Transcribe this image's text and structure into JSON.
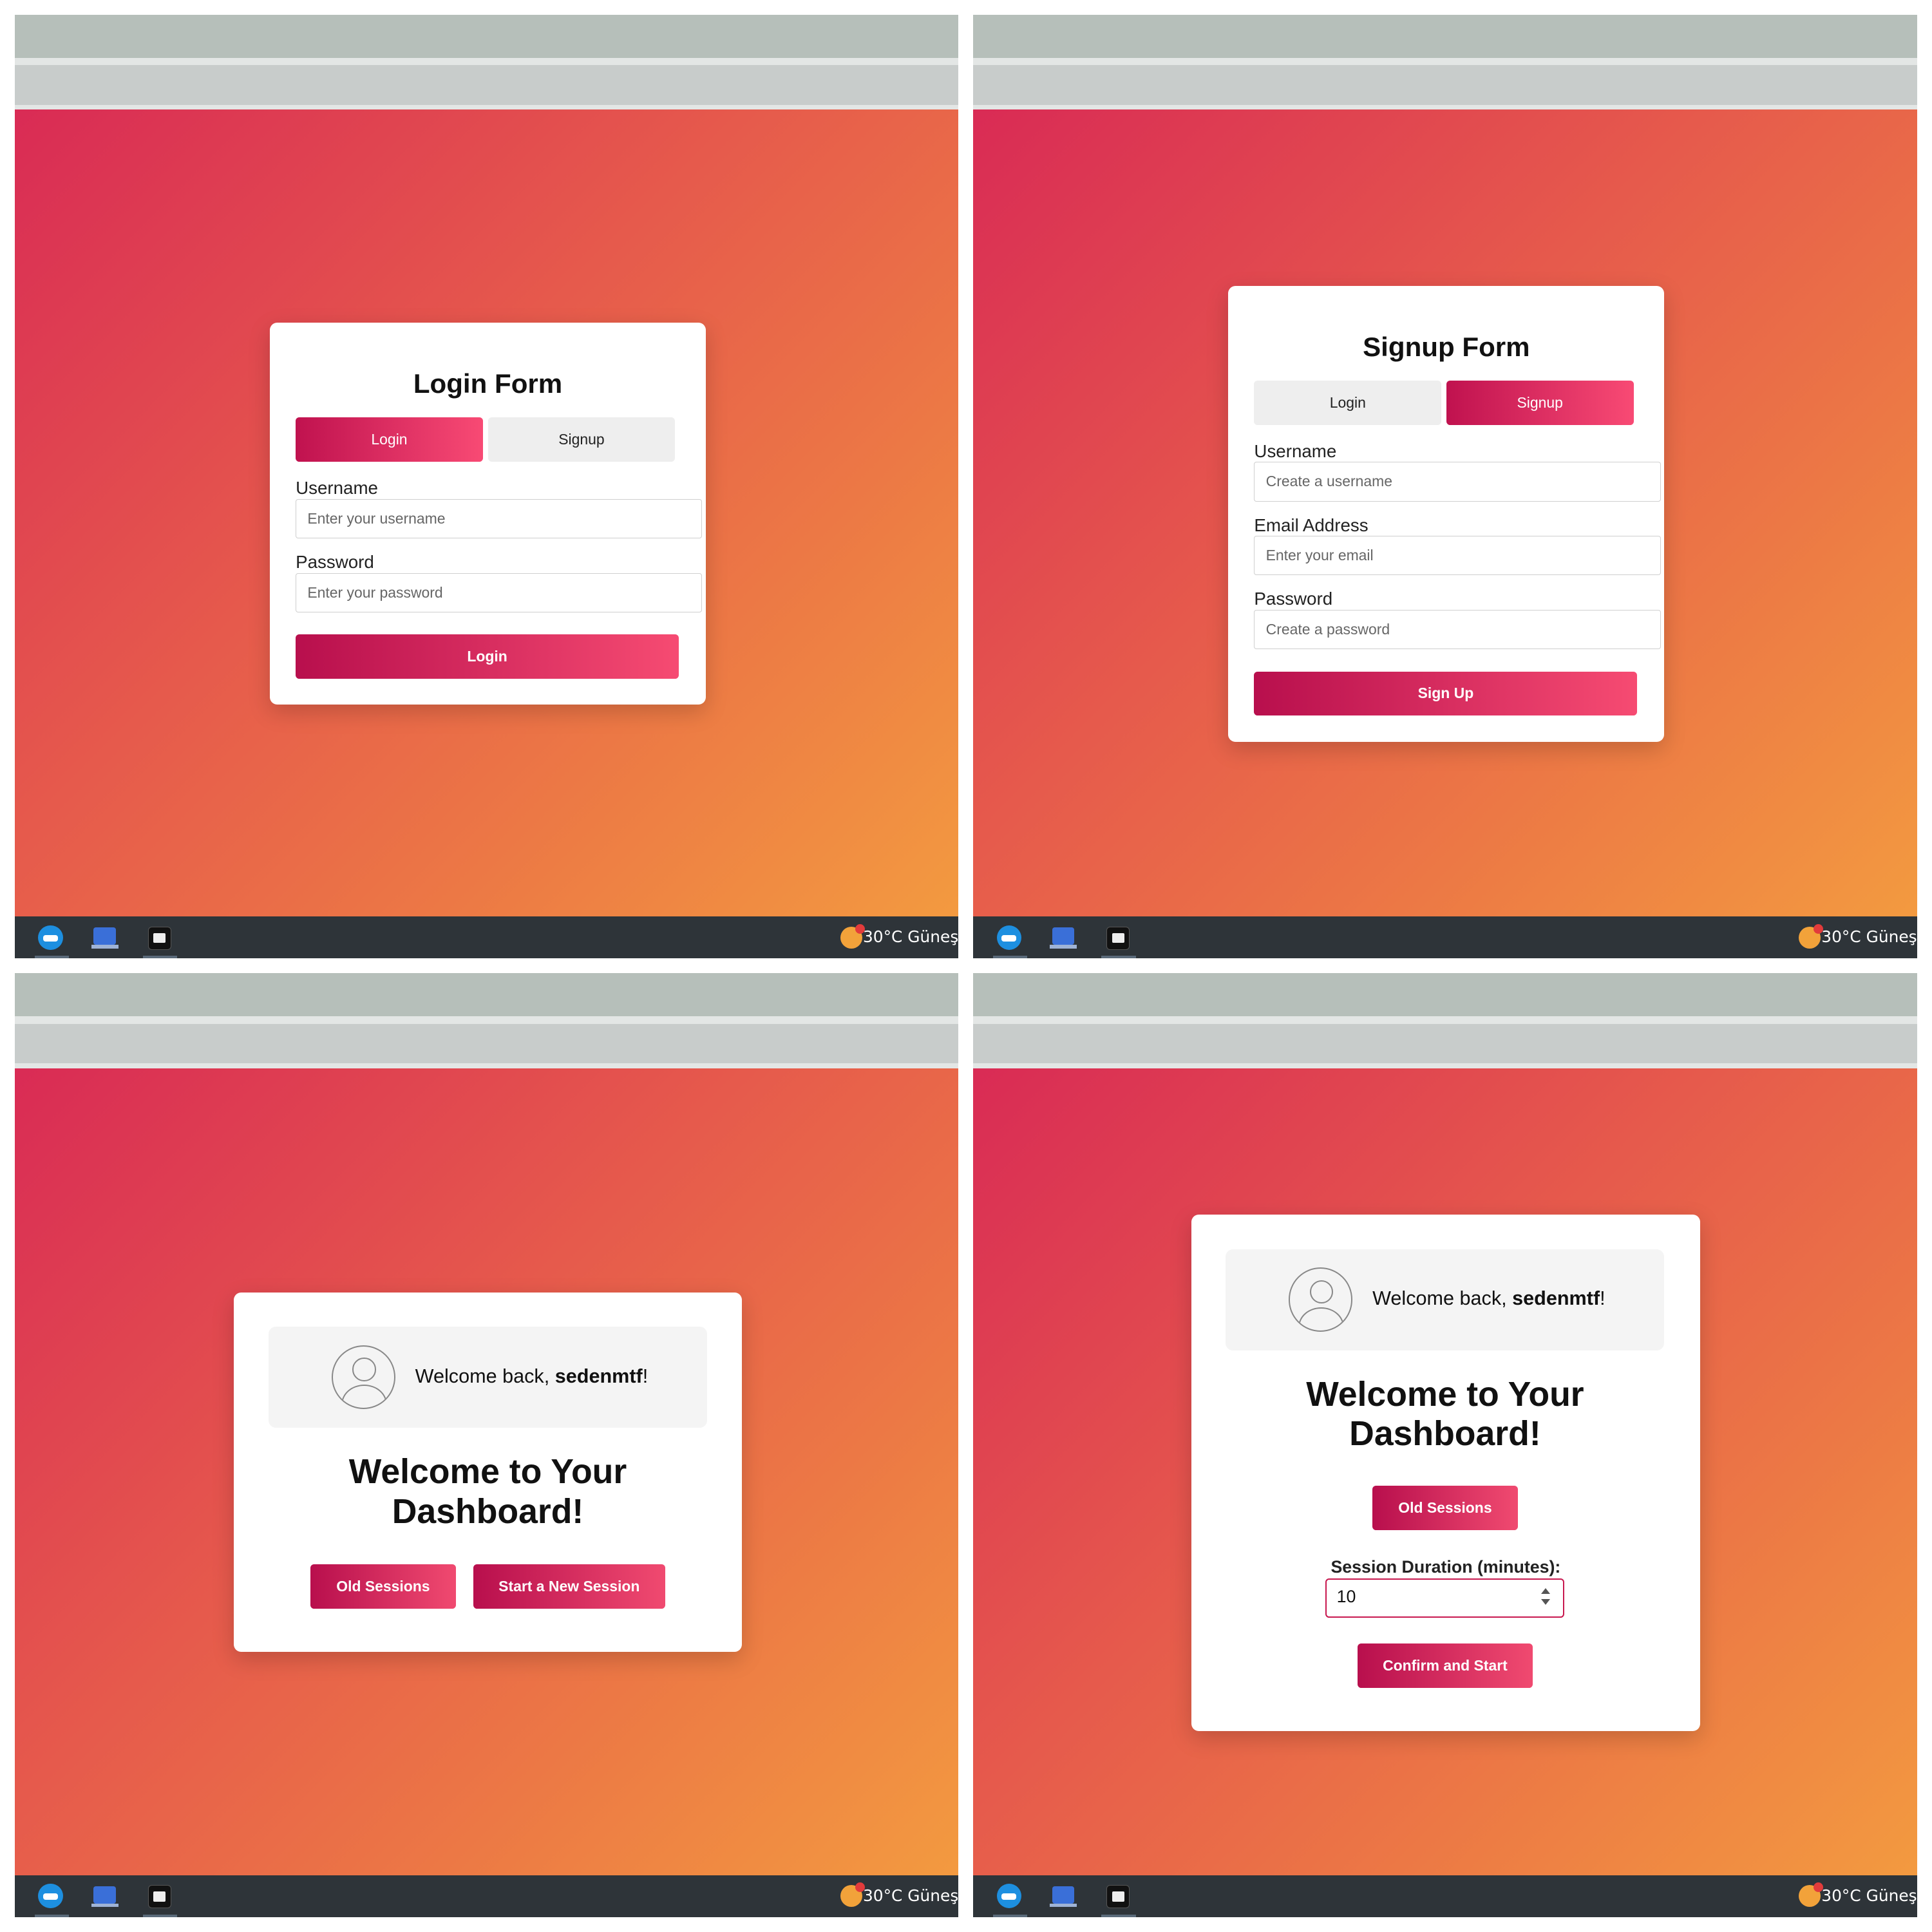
{
  "taskbar": {
    "weather": "30°C  Güneş"
  },
  "login_panel": {
    "title": "Login Form",
    "tab_login": "Login",
    "tab_signup": "Signup",
    "username_label": "Username",
    "username_placeholder": "Enter your username",
    "password_label": "Password",
    "password_placeholder": "Enter your password",
    "submit": "Login"
  },
  "signup_panel": {
    "title": "Signup Form",
    "tab_login": "Login",
    "tab_signup": "Signup",
    "username_label": "Username",
    "username_placeholder": "Create a username",
    "email_label": "Email Address",
    "email_placeholder": "Enter your email",
    "password_label": "Password",
    "password_placeholder": "Create a password",
    "submit": "Sign Up"
  },
  "dashboard_panel": {
    "welcome_prefix": "Welcome back, ",
    "username": "sedenmtf",
    "welcome_suffix": "!",
    "title": "Welcome to Your Dashboard!",
    "old_sessions": "Old Sessions",
    "new_session": "Start a New Session"
  },
  "session_panel": {
    "welcome_prefix": "Welcome back, ",
    "username": "sedenmtf",
    "welcome_suffix": "!",
    "title": "Welcome to Your Dashboard!",
    "old_sessions": "Old Sessions",
    "duration_label": "Session Duration (minutes):",
    "duration_value": "10",
    "confirm": "Confirm and Start"
  },
  "colors": {
    "accent": "#c0124f",
    "accent_light": "#f84a74",
    "gradient_start": "#d92b55",
    "gradient_end": "#f39a40"
  }
}
